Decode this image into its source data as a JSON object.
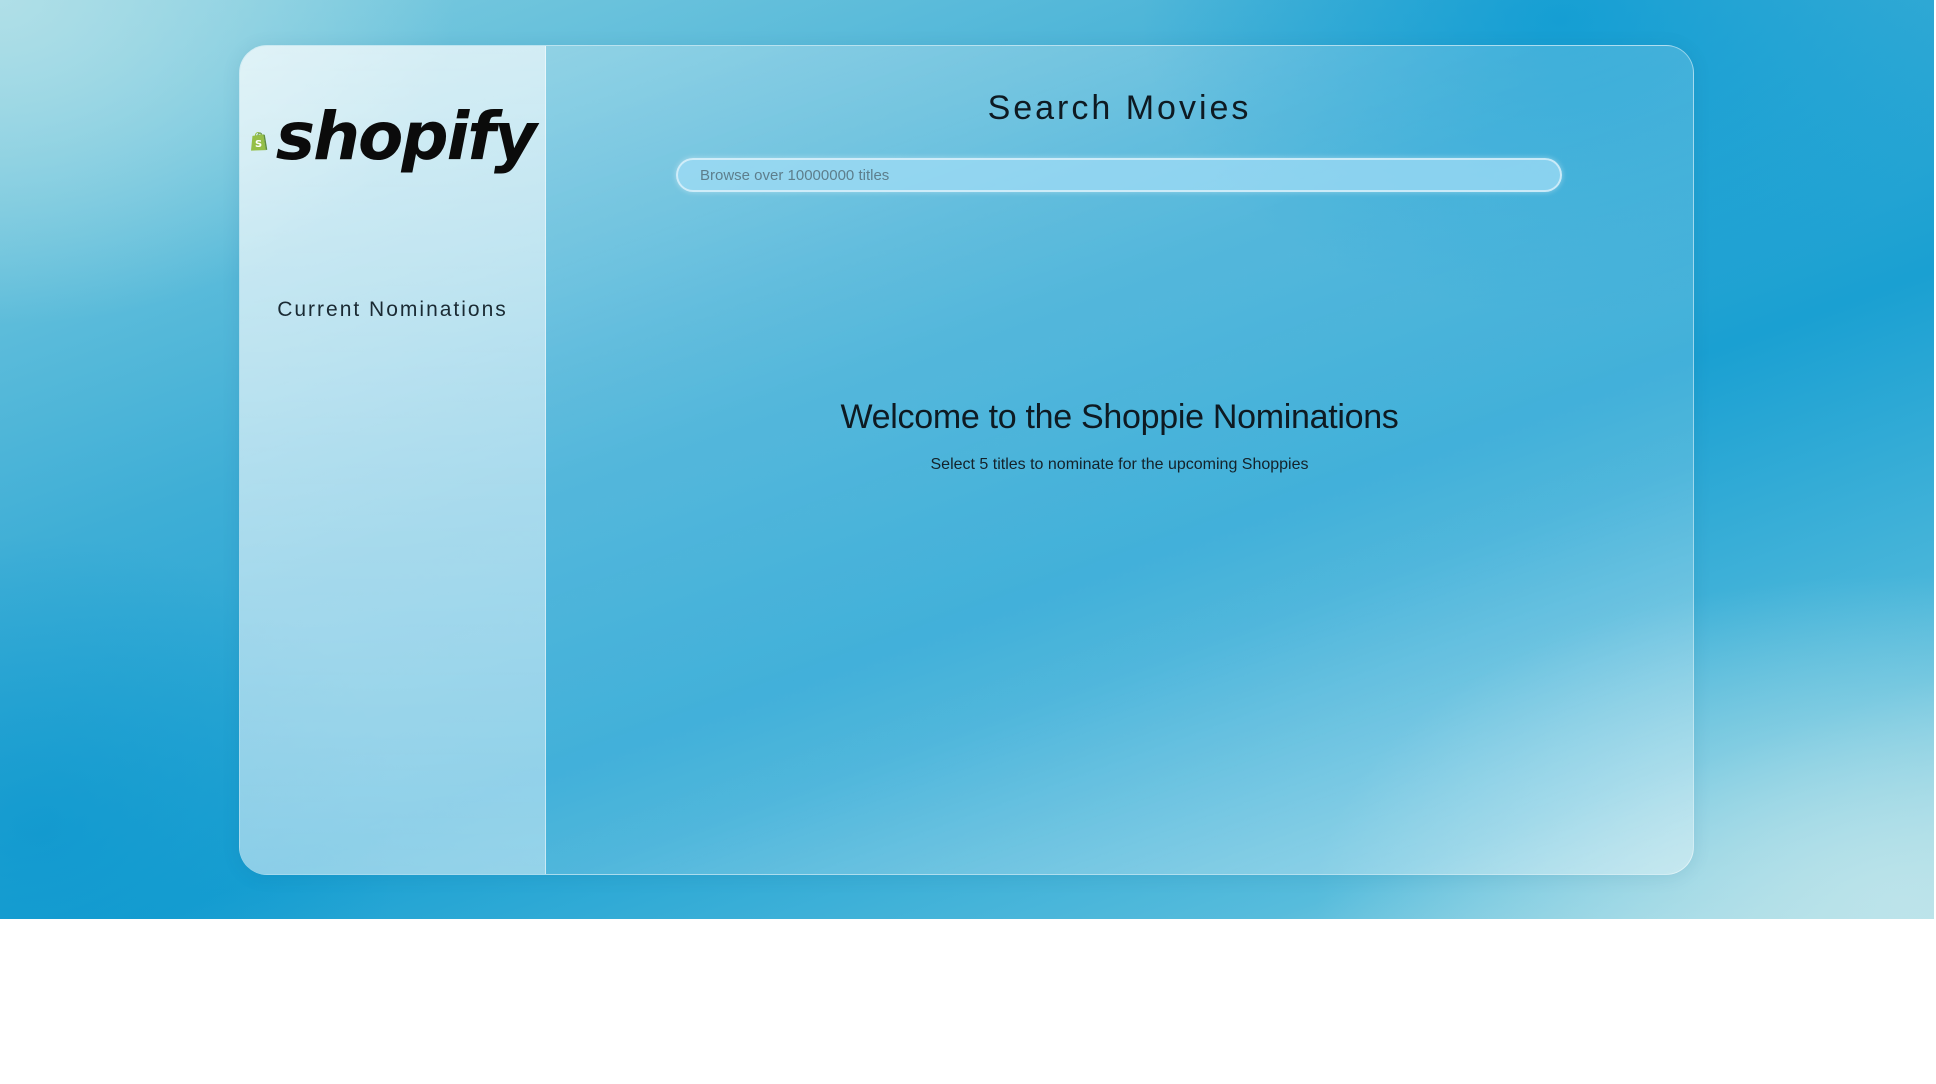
{
  "brand": {
    "logo_text": "shopify",
    "bag_color": "#95bf47",
    "bag_dark_color": "#5e8e3e"
  },
  "sidebar": {
    "title": "Current Nominations"
  },
  "search": {
    "title": "Search Movies",
    "placeholder": "Browse over 10000000 titles",
    "value": ""
  },
  "welcome": {
    "title": "Welcome to the Shoppie Nominations",
    "subtitle": "Select 5 titles to nominate for the upcoming Shoppies"
  },
  "colors": {
    "background_accent": "#1aa0d2",
    "text_dark": "#0e1a22"
  }
}
